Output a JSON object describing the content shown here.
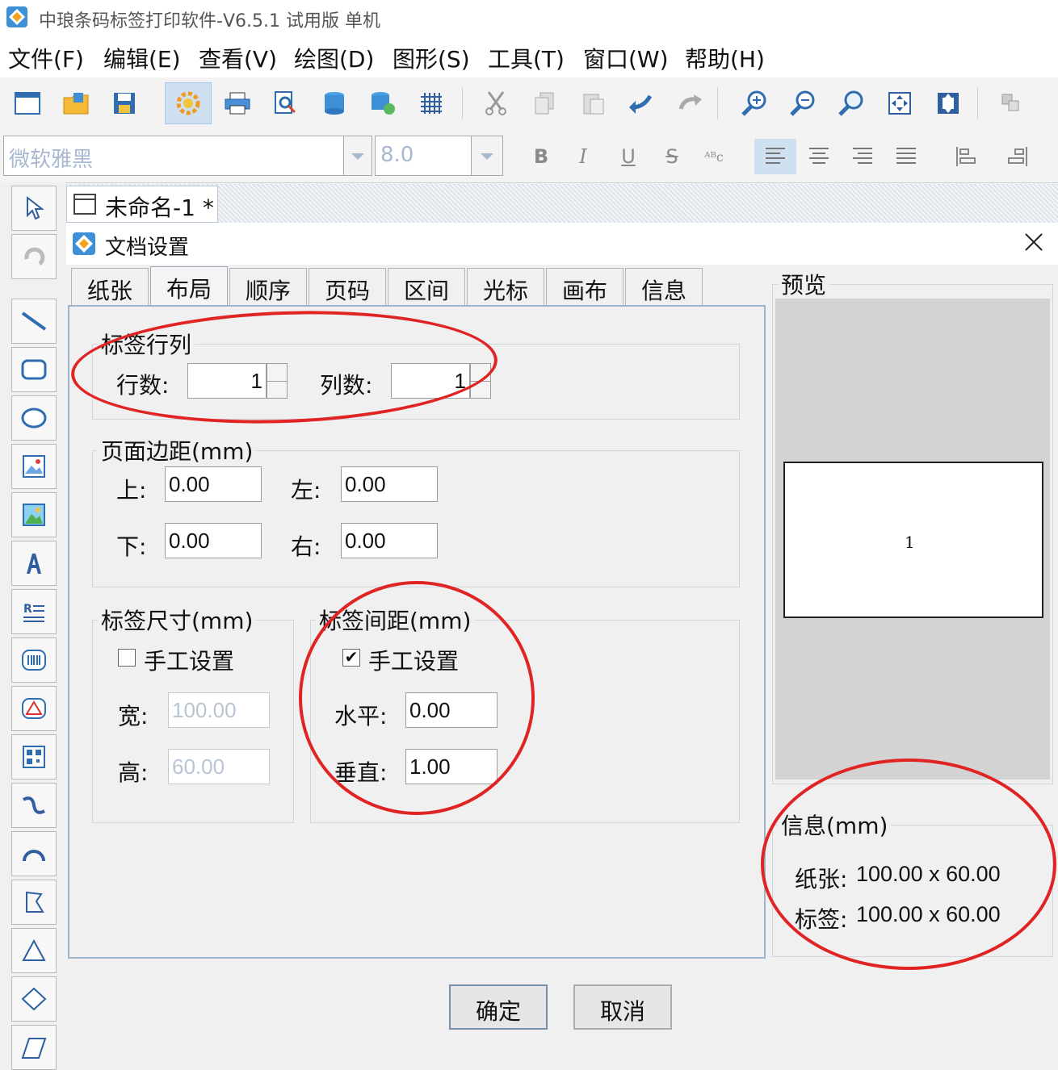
{
  "window": {
    "title": "中琅条码标签打印软件-V6.5.1 试用版 单机"
  },
  "menu": [
    {
      "label": "文件(F)"
    },
    {
      "label": "编辑(E)"
    },
    {
      "label": "查看(V)"
    },
    {
      "label": "绘图(D)"
    },
    {
      "label": "图形(S)"
    },
    {
      "label": "工具(T)"
    },
    {
      "label": "窗口(W)"
    },
    {
      "label": "帮助(H)"
    }
  ],
  "toolbar": {
    "icons": [
      "new-doc-icon",
      "open-folder-icon",
      "save-icon",
      "document-settings-icon",
      "print-icon",
      "print-preview-icon",
      "database-icon",
      "database-link-icon",
      "grid-icon",
      "cut-icon",
      "copy-icon",
      "paste-icon",
      "undo-icon",
      "redo-icon",
      "zoom-in-icon",
      "zoom-out-icon",
      "zoom-icon",
      "fit-page-icon",
      "actual-size-icon",
      "arrange-icon"
    ]
  },
  "format": {
    "font_name": "微软雅黑",
    "font_size": "8.0",
    "bold": "B",
    "italic": "I",
    "underline": "U",
    "strike": "S",
    "wrap": "ᴬᴮc"
  },
  "left_tools": [
    "select-arrow-icon",
    "rotate-icon",
    "line-icon",
    "rectangle-icon",
    "ellipse-icon",
    "image-icon",
    "picture-icon",
    "text-icon",
    "rich-text-icon",
    "barcode-icon",
    "shape-icon",
    "qrcode-icon",
    "curve-icon",
    "arc-icon",
    "polyline-icon",
    "triangle-icon",
    "diamond-icon",
    "parallelogram-icon"
  ],
  "doc_tab": {
    "label": "未命名-1 *"
  },
  "dialog": {
    "title": "文档设置",
    "tabs": [
      "纸张",
      "布局",
      "顺序",
      "页码",
      "区间",
      "光标",
      "画布",
      "信息"
    ],
    "active_tab": "布局",
    "rows_cols": {
      "legend": "标签行列",
      "rows_label": "行数:",
      "rows_value": "1",
      "cols_label": "列数:",
      "cols_value": "1"
    },
    "margins": {
      "legend": "页面边距(mm)",
      "top_label": "上:",
      "top_value": "0.00",
      "left_label": "左:",
      "left_value": "0.00",
      "bottom_label": "下:",
      "bottom_value": "0.00",
      "right_label": "右:",
      "right_value": "0.00"
    },
    "label_size": {
      "legend": "标签尺寸(mm)",
      "manual_label": "手工设置",
      "manual_checked": false,
      "width_label": "宽:",
      "width_value": "100.00",
      "height_label": "高:",
      "height_value": "60.00"
    },
    "label_gap": {
      "legend": "标签间距(mm)",
      "manual_label": "手工设置",
      "manual_checked": true,
      "check_mark": "✔",
      "horizontal_label": "水平:",
      "horizontal_value": "0.00",
      "vertical_label": "垂直:",
      "vertical_value": "1.00"
    },
    "preview": {
      "legend": "预览",
      "label_number": "1"
    },
    "info": {
      "legend": "信息(mm)",
      "paper_label": "纸张:",
      "paper_value": "100.00 x 60.00",
      "label_label": "标签:",
      "label_value": "100.00 x 60.00"
    },
    "ok_label": "确定",
    "cancel_label": "取消"
  },
  "colors": {
    "annotation_red": "#e02424",
    "toolbar_active": "#cfe0f1",
    "panel_border": "#9fb5cd"
  }
}
